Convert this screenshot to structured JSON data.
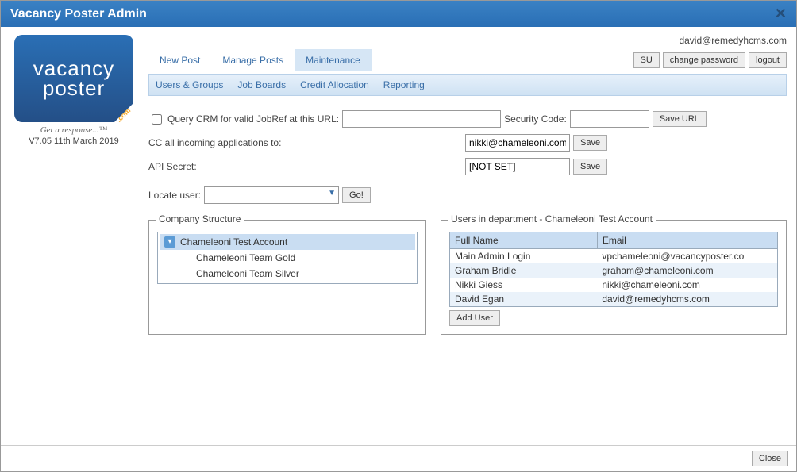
{
  "window": {
    "title": "Vacancy Poster Admin"
  },
  "sidebar": {
    "logo_line1": "vacancy",
    "logo_line2": "poster",
    "logo_corner": ".com",
    "tagline": "Get a response...™",
    "version": "V7.05 11th March 2019"
  },
  "header": {
    "user_email": "david@remedyhcms.com",
    "tabs": [
      "New Post",
      "Manage Posts",
      "Maintenance"
    ],
    "active_tab_index": 2,
    "buttons": {
      "su": "SU",
      "change_password": "change password",
      "logout": "logout"
    },
    "subtabs": [
      "Users & Groups",
      "Job Boards",
      "Credit Allocation",
      "Reporting"
    ],
    "active_subtab_index": 0
  },
  "form": {
    "query_crm_label": "Query CRM for valid JobRef at this URL:",
    "query_crm_checked": false,
    "query_crm_url": "",
    "security_code_label": "Security Code:",
    "security_code_value": "",
    "save_url_btn": "Save URL",
    "cc_label": "CC all incoming applications to:",
    "cc_value": "nikki@chameleoni.com",
    "cc_save_btn": "Save",
    "api_secret_label": "API Secret:",
    "api_secret_value": "[NOT SET]",
    "api_secret_save_btn": "Save",
    "locate_user_label": "Locate user:",
    "locate_user_value": "",
    "go_btn": "Go!"
  },
  "company_structure": {
    "legend": "Company Structure",
    "items": [
      {
        "label": "Chameleoni Test Account",
        "selected": true,
        "has_icon": true
      },
      {
        "label": "Chameleoni Team Gold",
        "selected": false,
        "has_icon": false
      },
      {
        "label": "Chameleoni Team Silver",
        "selected": false,
        "has_icon": false
      }
    ]
  },
  "users_panel": {
    "legend": "Users in department - Chameleoni Test Account",
    "columns": [
      "Full Name",
      "Email"
    ],
    "rows": [
      {
        "name": "Main Admin Login",
        "email": "vpchameleoni@vacancyposter.co"
      },
      {
        "name": "Graham Bridle",
        "email": "graham@chameleoni.com"
      },
      {
        "name": "Nikki Giess",
        "email": "nikki@chameleoni.com"
      },
      {
        "name": "David Egan",
        "email": "david@remedyhcms.com"
      }
    ],
    "add_user_btn": "Add User"
  },
  "footer": {
    "close_btn": "Close"
  }
}
